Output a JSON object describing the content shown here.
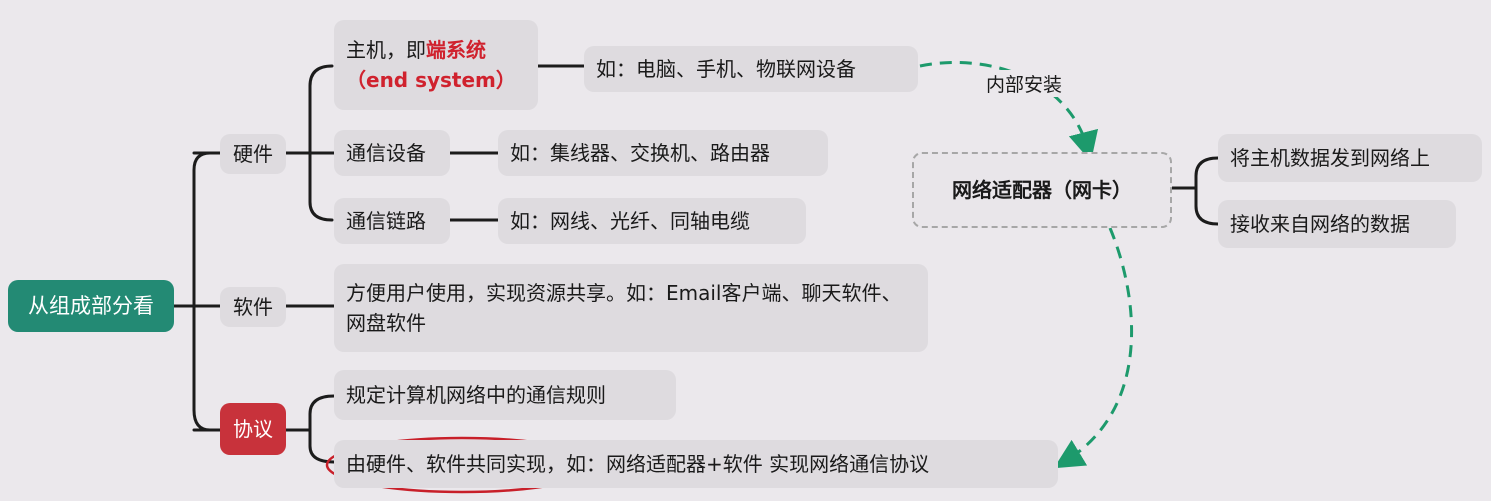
{
  "root": "从组成部分看",
  "branches": {
    "hardware": "硬件",
    "software": "软件",
    "protocol": "协议"
  },
  "hardware_items": {
    "host_prefix": "主机，即",
    "host_highlight": "端系统",
    "host_english": "（end system）",
    "host_example": "如：电脑、手机、物联网设备",
    "comm_device": "通信设备",
    "comm_device_example": "如：集线器、交换机、路由器",
    "comm_link": "通信链路",
    "comm_link_example": "如：网线、光纤、同轴电缆"
  },
  "software_desc": "方便用户使用，实现资源共享。如：Email客户端、聊天软件、网盘软件",
  "protocol_items": {
    "rules": "规定计算机网络中的通信规则",
    "implementation_circled": "由硬件、软件共同实现，",
    "implementation_example": "如：网络适配器+软件 实现网络通信协议"
  },
  "adapter": {
    "title": "网络适配器（网卡）",
    "func1": "将主机数据发到网络上",
    "func2": "接收来自网络的数据",
    "install_label": "内部安装"
  },
  "colors": {
    "root_bg": "#238a74",
    "protocol_bg": "#c8323b",
    "highlight_text": "#d0222e",
    "dashed_arrow": "#1d9a6c",
    "circle_mark": "#c8202a"
  }
}
